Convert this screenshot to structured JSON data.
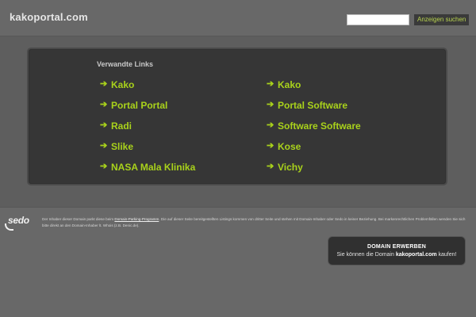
{
  "header": {
    "site_name": "kakoportal.com",
    "search_placeholder": "",
    "search_button": "Anzeigen suchen"
  },
  "related": {
    "heading": "Verwandte Links",
    "links": [
      "Kako",
      "Kako",
      "Portal Portal",
      "Portal Software",
      "Radi",
      "Software Software",
      "Slike",
      "Kose",
      "NASA Mala Klinika",
      "Vichy"
    ]
  },
  "footer": {
    "logo_text": "sedo",
    "disclaimer_before_link": "Der Inhaber dieser Domain parkt diese beim ",
    "disclaimer_link": "Domain-Parking-Programm",
    "disclaimer_after_link": ". Die auf dieser Seite bereitgestellten Listings kommen von dritter Seite und stehen mit Domain-Inhaber oder Sedo in keiner Beziehung. Bei markenrechtlichen Problemfällen wenden Sie sich bitte direkt an den Domain-Inhaber lt. Whois (z.B. Denic.de).",
    "buy_title": "DOMAIN ERWERBEN",
    "buy_text_before": "Sie können die Domain ",
    "buy_domain": "kakoportal.com",
    "buy_text_after": " kaufen!"
  },
  "colors": {
    "background": "#686868",
    "panel": "#363636",
    "link_green": "#a9d21b"
  },
  "icons": {
    "link_arrow": "arrow-right-icon"
  }
}
